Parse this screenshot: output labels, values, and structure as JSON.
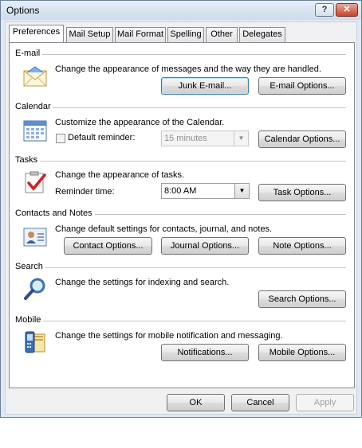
{
  "window": {
    "title": "Options"
  },
  "tabs": [
    {
      "label": "Preferences"
    },
    {
      "label": "Mail Setup"
    },
    {
      "label": "Mail Format"
    },
    {
      "label": "Spelling"
    },
    {
      "label": "Other"
    },
    {
      "label": "Delegates"
    }
  ],
  "email": {
    "heading": "E-mail",
    "description": "Change the appearance of messages and the way they are handled.",
    "junk_button": "Junk E-mail...",
    "options_button": "E-mail Options..."
  },
  "calendar": {
    "heading": "Calendar",
    "description": "Customize the appearance of the Calendar.",
    "reminder_label": "Default reminder:",
    "reminder_value": "15 minutes",
    "options_button": "Calendar Options..."
  },
  "tasks": {
    "heading": "Tasks",
    "description": "Change the appearance of tasks.",
    "reminder_label": "Reminder time:",
    "reminder_value": "8:00 AM",
    "options_button": "Task Options..."
  },
  "contacts": {
    "heading": "Contacts and Notes",
    "description": "Change default settings for contacts, journal, and notes.",
    "contact_button": "Contact Options...",
    "journal_button": "Journal Options...",
    "note_button": "Note Options..."
  },
  "search": {
    "heading": "Search",
    "description": "Change the settings for indexing and search.",
    "options_button": "Search Options..."
  },
  "mobile": {
    "heading": "Mobile",
    "description": "Change the settings for mobile notification and messaging.",
    "notifications_button": "Notifications...",
    "options_button": "Mobile Options..."
  },
  "footer": {
    "ok": "OK",
    "cancel": "Cancel",
    "apply": "Apply"
  },
  "icons": [
    "envelope-icon",
    "calendar-icon",
    "task-checkbox-icon",
    "contact-card-icon",
    "magnifier-icon",
    "mobile-device-icon",
    "help-icon",
    "close-icon"
  ]
}
